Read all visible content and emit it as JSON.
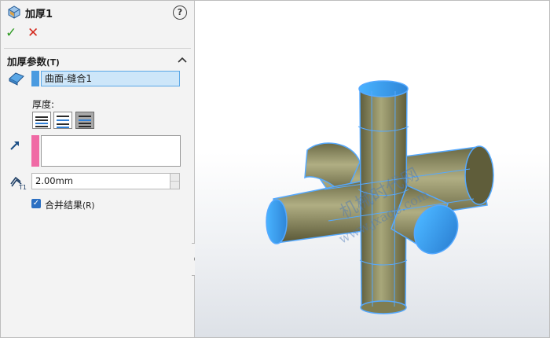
{
  "panel": {
    "title": "加厚1",
    "help_icon": "?",
    "ok_icon": "✓",
    "cancel_icon": "✕",
    "section_title": "加厚参数",
    "section_shortcut": "(T)",
    "surface_selection": "曲面-缝合1",
    "thickness_label": "厚度:",
    "thickness_value": "2.00mm",
    "merge_label": "合并结果",
    "merge_shortcut": "(R)",
    "merge_checked": true,
    "colors": {
      "accent_blue": "#4b9be0",
      "selection_fill": "#cde6f9",
      "pink": "#f06aa5",
      "ok": "#2e9a22",
      "cancel": "#d42a1e"
    }
  },
  "viewport": {
    "watermark_cn": "机械时代网",
    "watermark_url": "www.jxage.com",
    "model_colors": {
      "highlight": "#55a9ff",
      "surface": "#8e8c5c"
    }
  }
}
